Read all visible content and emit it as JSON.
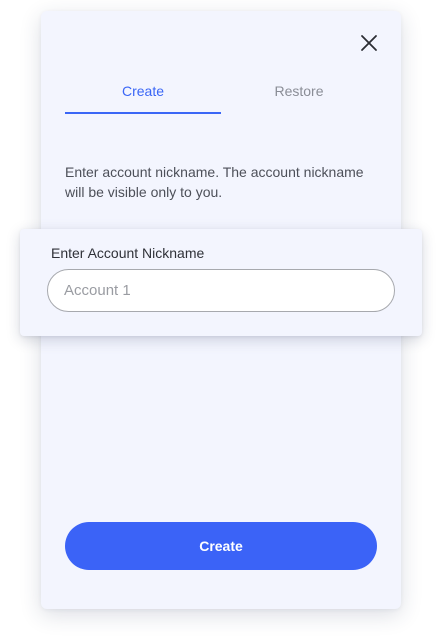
{
  "modal": {
    "close_icon": "close-icon",
    "tabs": [
      {
        "label": "Create",
        "active": true
      },
      {
        "label": "Restore",
        "active": false
      }
    ],
    "description": "Enter account nickname. The account nickname will be visible only to you.",
    "nickname_field": {
      "label": "Enter Account Nickname",
      "value": "",
      "placeholder": "Account 1"
    },
    "submit_label": "Create"
  },
  "colors": {
    "accent": "#3a66f6",
    "panel_background": "#f3f5fe",
    "muted_text": "#8a8d96"
  }
}
